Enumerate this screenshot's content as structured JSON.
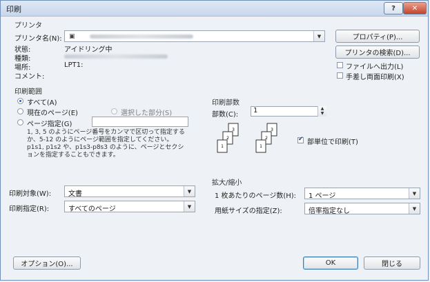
{
  "window": {
    "title": "印刷",
    "help_label": "?",
    "close_label": "✕"
  },
  "printer": {
    "section_label": "プリンタ",
    "name_label": "プリンタ名(N):",
    "status_label": "状態:",
    "status_value": "アイドリング中",
    "type_label": "種類:",
    "location_label": "場所:",
    "location_value": "LPT1:",
    "comment_label": "コメント:",
    "properties_button": "プロパティ(P)...",
    "find_printer_button": "プリンタの検索(D)...",
    "print_to_file_label": "ファイルへ出力(L)",
    "manual_duplex_label": "手差し両面印刷(X)",
    "print_to_file_checked": false,
    "manual_duplex_checked": false
  },
  "page_range": {
    "section_label": "印刷範囲",
    "all_label": "すべて(A)",
    "current_page_label": "現在のページ(E)",
    "selection_label": "選択した部分(S)",
    "pages_label": "ページ指定(G)",
    "pages_value": "",
    "hint": "1, 3, 5 のようにページ番号をカンマで区切って指定するか、5-12 のようにページ範囲を指定してください。p1s1, p1s2 や、p1s3-p8s3 のように、ページとセクションを指定することもできます。"
  },
  "copies": {
    "section_label": "印刷部数",
    "count_label": "部数(C):",
    "count_value": "1",
    "collate_label": "部単位で印刷(T)",
    "collate_checked": true
  },
  "print_what": {
    "label": "印刷対象(W):",
    "value": "文書"
  },
  "print_pages": {
    "label": "印刷指定(R):",
    "value": "すべてのページ"
  },
  "zoom": {
    "section_label": "拡大/縮小",
    "pages_per_sheet_label": "1 枚あたりのページ数(H):",
    "pages_per_sheet_value": "1 ページ",
    "scale_label": "用紙サイズの指定(Z):",
    "scale_value": "倍率指定なし"
  },
  "footer": {
    "options_button": "オプション(O)...",
    "ok_button": "OK",
    "close_button": "閉じる"
  }
}
